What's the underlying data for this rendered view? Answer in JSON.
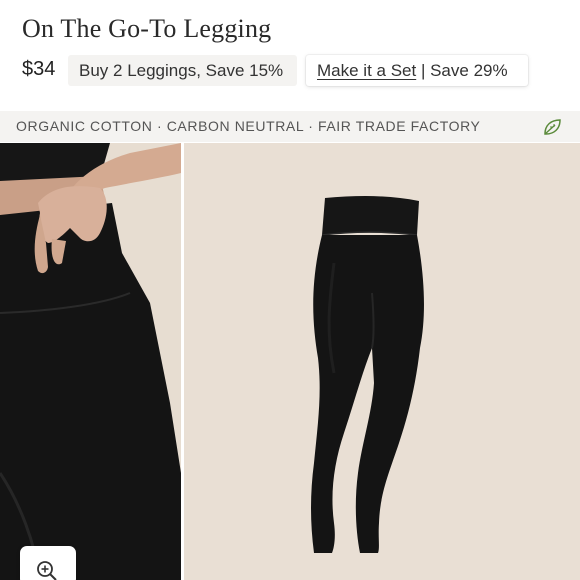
{
  "product": {
    "title": "On The Go-To Legging",
    "price": "$34"
  },
  "promos": {
    "bundle_label": "Buy 2 Leggings, Save 15%",
    "set_link_label": "Make it a Set",
    "set_separator": " | ",
    "set_savings": "Save 29%"
  },
  "badges": {
    "text": "ORGANIC COTTON · CARBON NEUTRAL · FAIR TRADE FACTORY",
    "icon": "leaf-icon"
  },
  "gallery": {
    "images": [
      {
        "name": "waistband-closeup-photo"
      },
      {
        "name": "legging-product-photo"
      }
    ],
    "zoom_icon": "zoom-in-icon"
  },
  "colors": {
    "badge_bg": "#f4f3f1",
    "leaf_green": "#5a8a3a",
    "photo_bg": "#e9dfd4",
    "legging": "#141414"
  }
}
